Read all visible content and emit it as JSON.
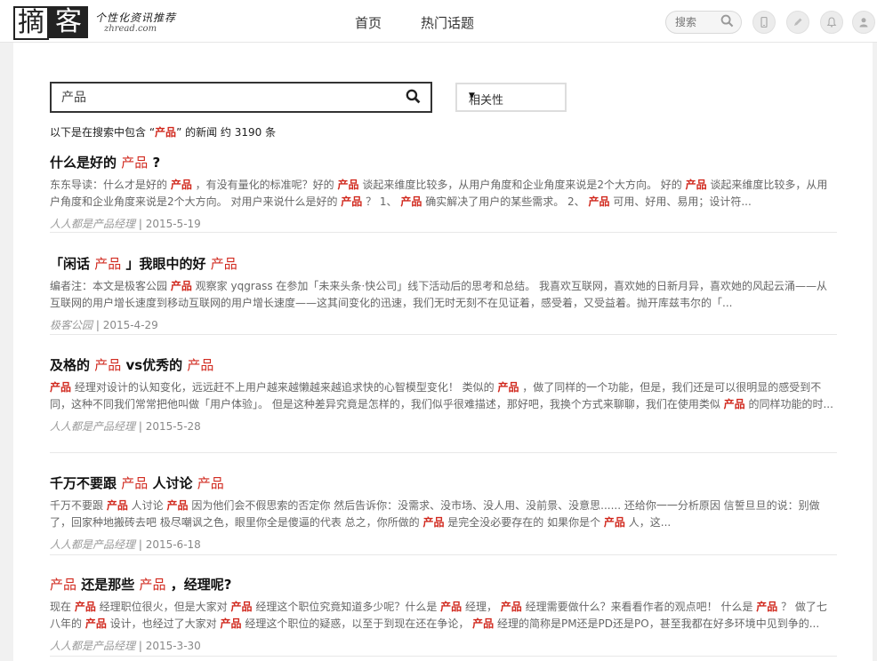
{
  "header": {
    "logo_left": "摘",
    "logo_right": "客",
    "slogan": "个性化资讯推荐",
    "domain": "zhread.com",
    "nav": [
      "首页",
      "热门话题"
    ],
    "search_placeholder": "搜索",
    "icons": [
      "mobile-icon",
      "pen-icon",
      "bell-icon",
      "user-icon"
    ]
  },
  "search": {
    "query": "产品",
    "sort": "相关性",
    "summary_pre": "以下是在搜索中包含 “",
    "summary_term": "产品",
    "summary_post": "” 的新闻 约 3190 条"
  },
  "results": [
    {
      "title": [
        [
          "什么是好的 ",
          0
        ],
        [
          "产品",
          1
        ],
        [
          " ?",
          0
        ]
      ],
      "snippet": [
        [
          "东东导读：什么才是好的 ",
          0
        ],
        [
          "产品",
          1
        ],
        [
          " ，有没有量化的标准呢？好的 ",
          0
        ],
        [
          "产品",
          1
        ],
        [
          " 谈起来维度比较多，从用户角度和企业角度来说是2个大方向。 好的 ",
          0
        ],
        [
          "产品",
          1
        ],
        [
          " 谈起来维度比较多，从用户角度和企业角度来说是2个大方向。 对用户来说什么是好的 ",
          0
        ],
        [
          "产品",
          1
        ],
        [
          " ？ 1、 ",
          0
        ],
        [
          "产品",
          1
        ],
        [
          " 确实解决了用户的某些需求。 2、 ",
          0
        ],
        [
          "产品",
          1
        ],
        [
          " 可用、好用、易用；设计符...",
          0
        ]
      ],
      "source": "人人都是产品经理",
      "date": "2015-5-19"
    },
    {
      "title": [
        [
          "「闲话 ",
          0
        ],
        [
          "产品",
          1
        ],
        [
          " 」我眼中的好 ",
          0
        ],
        [
          "产品",
          1
        ]
      ],
      "snippet": [
        [
          "编者注：本文是极客公园 ",
          0
        ],
        [
          "产品",
          1
        ],
        [
          " 观察家 yqgrass 在参加「未来头条·快公司」线下活动后的思考和总结。 我喜欢互联网，喜欢她的日新月异，喜欢她的风起云涌——从互联网的用户增长速度到移动互联网的用户增长速度——这其间变化的迅速，我们无时无刻不在见证着，感受着，又受益着。抛开库兹韦尔的「...",
          0
        ]
      ],
      "source": "极客公园",
      "date": "2015-4-29"
    },
    {
      "title": [
        [
          "及格的 ",
          0
        ],
        [
          "产品",
          1
        ],
        [
          " vs优秀的 ",
          0
        ],
        [
          "产品",
          1
        ]
      ],
      "snippet": [
        [
          "产品",
          1
        ],
        [
          " 经理对设计的认知变化，远远赶不上用户越来越懒越来越追求快的心智模型变化！ 类似的 ",
          0
        ],
        [
          "产品",
          1
        ],
        [
          " ，做了同样的一个功能，但是，我们还是可以很明显的感受到不同，这种不同我们常常把他叫做「用户体验」。 但是这种差异究竟是怎样的，我们似乎很难描述，那好吧，我换个方式来聊聊，我们在使用类似 ",
          0
        ],
        [
          "产品",
          1
        ],
        [
          " 的同样功能的时...",
          0
        ]
      ],
      "source": "人人都是产品经理",
      "date": "2015-5-28"
    },
    {
      "title": [
        [
          "千万不要跟 ",
          0
        ],
        [
          "产品",
          1
        ],
        [
          " 人讨论 ",
          0
        ],
        [
          "产品",
          1
        ]
      ],
      "snippet": [
        [
          "千万不要跟 ",
          0
        ],
        [
          "产品",
          1
        ],
        [
          " 人讨论 ",
          0
        ],
        [
          "产品",
          1
        ],
        [
          " 因为他们会不假思索的否定你 然后告诉你：没需求、没市场、没人用、没前景、没意思...... 还给你一一分析原因 信誓旦旦的说：别做了，回家种地搬砖去吧 极尽嘲讽之色，眼里你全是傻逼的代表 总之，你所做的 ",
          0
        ],
        [
          "产品",
          1
        ],
        [
          " 是完全没必要存在的 如果你是个 ",
          0
        ],
        [
          "产品",
          1
        ],
        [
          " 人，这...",
          0
        ]
      ],
      "source": "人人都是产品经理",
      "date": "2015-6-18"
    },
    {
      "title": [
        [
          "产品",
          1
        ],
        [
          " 还是那些 ",
          0
        ],
        [
          "产品",
          1
        ],
        [
          " ，经理呢?",
          0
        ]
      ],
      "snippet": [
        [
          "现在 ",
          0
        ],
        [
          "产品",
          1
        ],
        [
          " 经理职位很火，但是大家对 ",
          0
        ],
        [
          "产品",
          1
        ],
        [
          " 经理这个职位究竟知道多少呢？什么是 ",
          0
        ],
        [
          "产品",
          1
        ],
        [
          " 经理， ",
          0
        ],
        [
          "产品",
          1
        ],
        [
          " 经理需要做什么？来看看作者的观点吧！ 什么是 ",
          0
        ],
        [
          "产品",
          1
        ],
        [
          " ？ 做了七八年的 ",
          0
        ],
        [
          "产品",
          1
        ],
        [
          " 设计，也经过了大家对 ",
          0
        ],
        [
          "产品",
          1
        ],
        [
          " 经理这个职位的疑惑，以至于到现在还在争论， ",
          0
        ],
        [
          "产品",
          1
        ],
        [
          " 经理的简称是PM还是PD还是PO，甚至我都在好多环境中见到争的...",
          0
        ]
      ],
      "source": "人人都是产品经理",
      "date": "2015-3-30"
    }
  ],
  "colors": {
    "highlight": "#d12a1f",
    "text": "#333333",
    "snippet": "#666666"
  }
}
